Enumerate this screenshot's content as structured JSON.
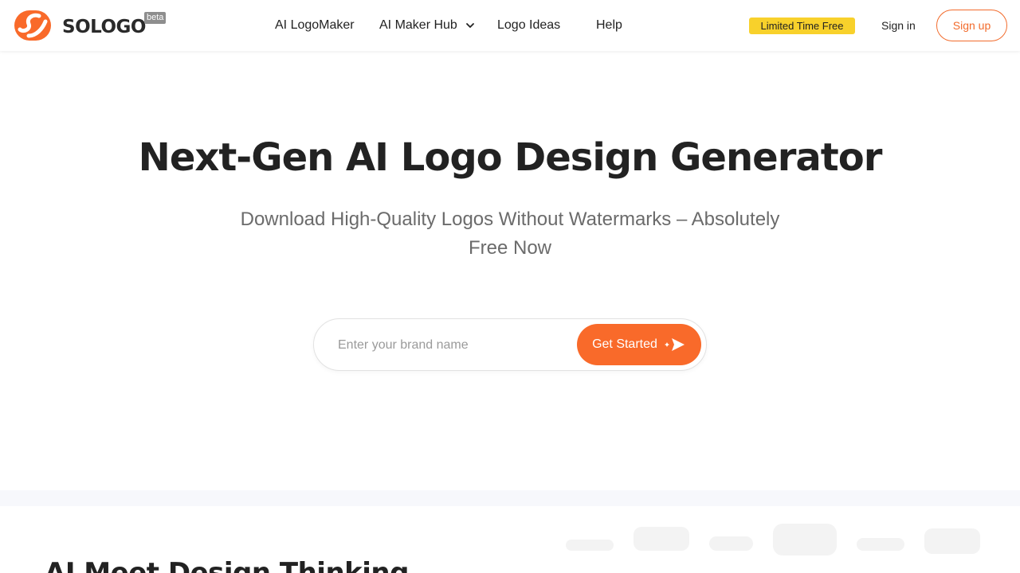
{
  "brand": {
    "name": "SOLOGO",
    "beta_label": "beta",
    "accent_color": "#f96a2a",
    "promo_color": "#f8d12b"
  },
  "nav": {
    "items": [
      {
        "label": "AI LogoMaker"
      },
      {
        "label": "AI Maker Hub",
        "has_dropdown": true
      },
      {
        "label": "Logo Ideas"
      },
      {
        "label": "Help"
      }
    ]
  },
  "header_actions": {
    "promo_badge": "Limited Time Free",
    "signin_label": "Sign in",
    "signup_label": "Sign up"
  },
  "hero": {
    "title": "Next-Gen AI Logo Design Generator",
    "subtitle": "Download High-Quality Logos Without Watermarks – Absolutely Free Now"
  },
  "search": {
    "placeholder": "Enter your brand name",
    "value": "",
    "button_label": "Get Started",
    "button_icon": "send-sparkle-icon"
  },
  "section2": {
    "title": "AI Meet Design Thinking"
  }
}
